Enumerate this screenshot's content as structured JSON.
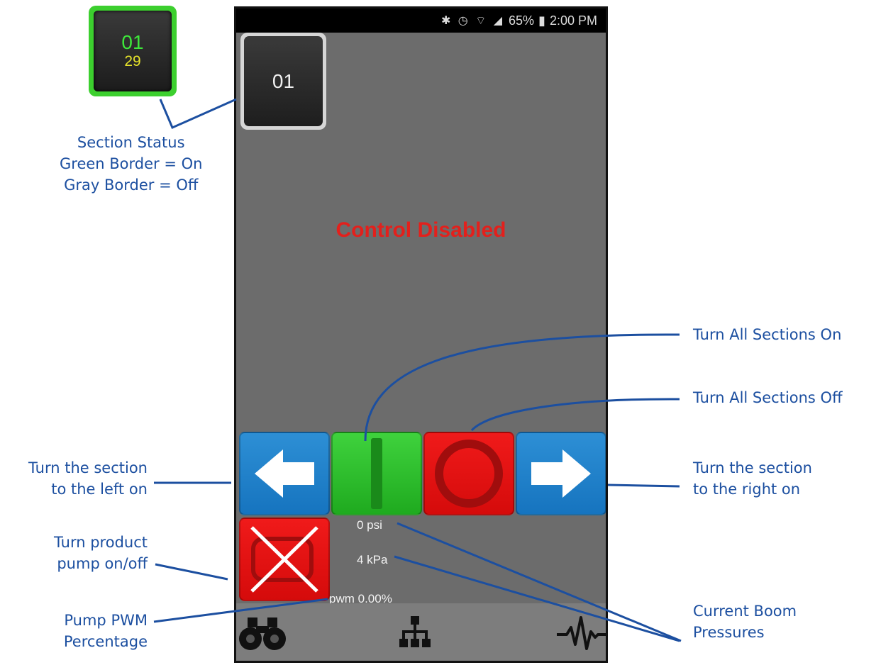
{
  "inset": {
    "section_number": "01",
    "section_count": "29",
    "border_color": "#3ccf2e"
  },
  "status_bar": {
    "icons": "✱ ◷ ⌔ ◢",
    "battery": "65%",
    "time": "2:00 PM"
  },
  "section_tile": {
    "label": "01"
  },
  "message": {
    "text": "Control Disabled",
    "color": "#e3201c"
  },
  "readouts": {
    "pressure_psi": "0 psi",
    "pressure_kpa": "4 kPa",
    "pwm": "pwm 0.00%"
  },
  "bottom_nav": {
    "items": [
      "binoculars-icon",
      "network-icon",
      "waveform-icon"
    ]
  },
  "annotations": {
    "section_status": [
      "Section Status",
      "Green Border = On",
      "Gray Border = Off"
    ],
    "all_on": "Turn All Sections On",
    "all_off": "Turn All Sections Off",
    "left_on": [
      "Turn the section",
      "to the left on"
    ],
    "right_on": [
      "Turn the section",
      "to the right on"
    ],
    "pump": [
      "Turn product",
      "pump on/off"
    ],
    "pwm": [
      "Pump PWM",
      "Percentage"
    ],
    "pressures": [
      "Current Boom",
      "Pressures"
    ]
  },
  "colors": {
    "callout": "#1c4fa0",
    "button_blue": "#1f80c8",
    "button_green": "#2fc02d",
    "button_red": "#e31313"
  }
}
